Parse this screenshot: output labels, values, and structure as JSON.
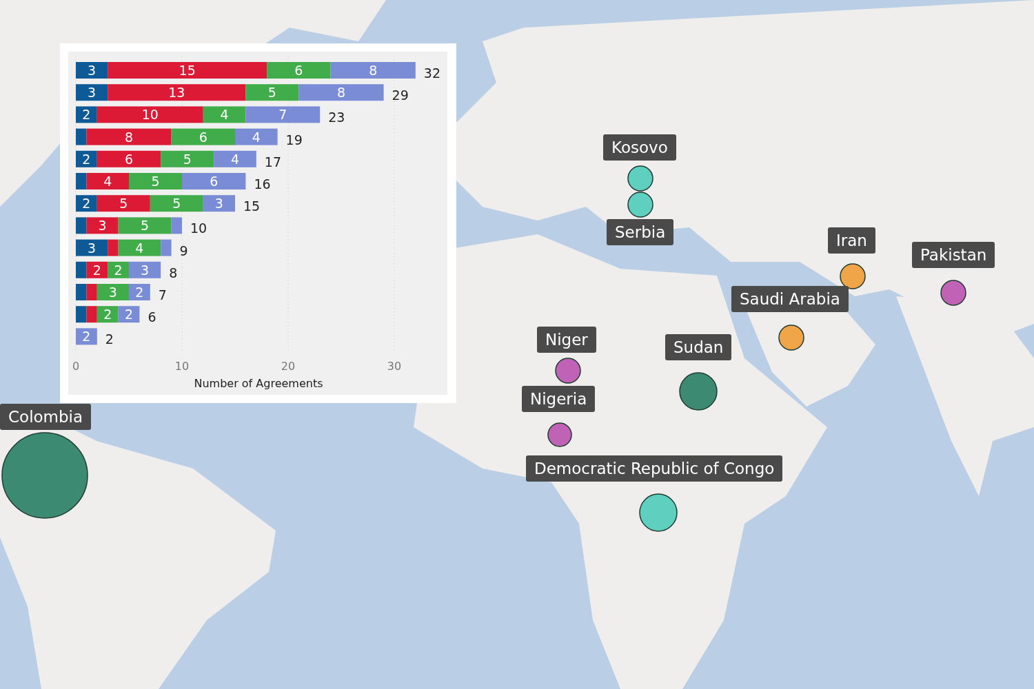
{
  "map": {
    "kind": "picture",
    "markers": [
      {
        "label": "Kosovo",
        "color": "#5fd0c0"
      },
      {
        "label": "Serbia",
        "color": "#5fd0c0"
      },
      {
        "label": "Iran",
        "color": "#f0a548"
      },
      {
        "label": "Pakistan",
        "color": "#c063b6"
      },
      {
        "label": "Saudi Arabia",
        "color": "#f0a548"
      },
      {
        "label": "Niger",
        "color": "#c063b6"
      },
      {
        "label": "Sudan",
        "color": "#3d8a72"
      },
      {
        "label": "Nigeria",
        "color": "#c063b6"
      },
      {
        "label": "Colombia",
        "color": "#3d8a72"
      },
      {
        "label": "Democratic Republic of Congo",
        "color": "#5fd0c0"
      }
    ]
  },
  "chart": {
    "chart_data": {
      "type": "bar",
      "orientation": "horizontal",
      "stacked": true,
      "grid": true,
      "xlabel": "Number of Agreements",
      "xlim": [
        0,
        35
      ],
      "xticks": [
        0,
        10,
        20,
        30
      ],
      "series": [
        {
          "color": "#0e5a96",
          "values": [
            3,
            3,
            2,
            1,
            2,
            1,
            2,
            1,
            3,
            1,
            1,
            1,
            null
          ],
          "value_labels": [
            "3",
            "3",
            "2",
            null,
            "2",
            null,
            "2",
            null,
            "3",
            null,
            null,
            null,
            null
          ]
        },
        {
          "color": "#dc1a35",
          "values": [
            15,
            13,
            10,
            8,
            6,
            4,
            5,
            3,
            1,
            2,
            1,
            1,
            null
          ],
          "value_labels": [
            "15",
            "13",
            "10",
            "8",
            "6",
            "4",
            "5",
            "3",
            null,
            "2",
            null,
            null,
            null
          ]
        },
        {
          "color": "#40ad4a",
          "values": [
            6,
            5,
            4,
            6,
            5,
            5,
            5,
            5,
            4,
            2,
            3,
            2,
            null
          ],
          "value_labels": [
            "6",
            "5",
            "4",
            "6",
            "5",
            "5",
            "5",
            "5",
            "4",
            "2",
            "3",
            "2",
            null
          ]
        },
        {
          "color": "#7b8cd6",
          "values": [
            8,
            8,
            7,
            4,
            4,
            6,
            3,
            1,
            1,
            3,
            2,
            2,
            2
          ],
          "value_labels": [
            "8",
            "8",
            "7",
            "4",
            "4",
            "6",
            "3",
            null,
            null,
            "3",
            "2",
            "2",
            "2"
          ]
        }
      ],
      "annotations": [
        "32",
        "29",
        "23",
        "19",
        "17",
        "16",
        "15",
        "10",
        "9",
        "8",
        "7",
        "6",
        "2"
      ]
    }
  }
}
